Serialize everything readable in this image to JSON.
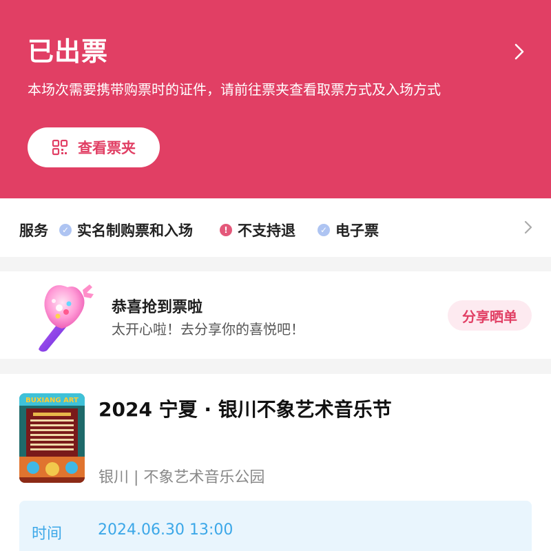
{
  "header": {
    "title": "已出票",
    "description": "本场次需要携带购票时的证件，请前往票夹查看取票方式及入场方式",
    "wallet_button_label": "查看票夹",
    "background_color": "#e13f64"
  },
  "services": {
    "label": "服务",
    "items": [
      {
        "label": "实名制购票和入场",
        "icon": "check-icon"
      },
      {
        "label": "不支持退",
        "icon": "exclamation-icon"
      },
      {
        "label": "电子票",
        "icon": "check-icon"
      }
    ]
  },
  "share": {
    "title": "恭喜抢到票啦",
    "subtitle": "太开心啦！去分享你的喜悦吧！",
    "button_label": "分享晒单"
  },
  "event": {
    "poster_title": "BUXIANG ART",
    "title": "2024 宁夏 · 银川不象艺术音乐节",
    "venue": "银川 | 不象艺术音乐公园",
    "time_label": "时间",
    "time_value": "2024.06.30 13:00"
  }
}
